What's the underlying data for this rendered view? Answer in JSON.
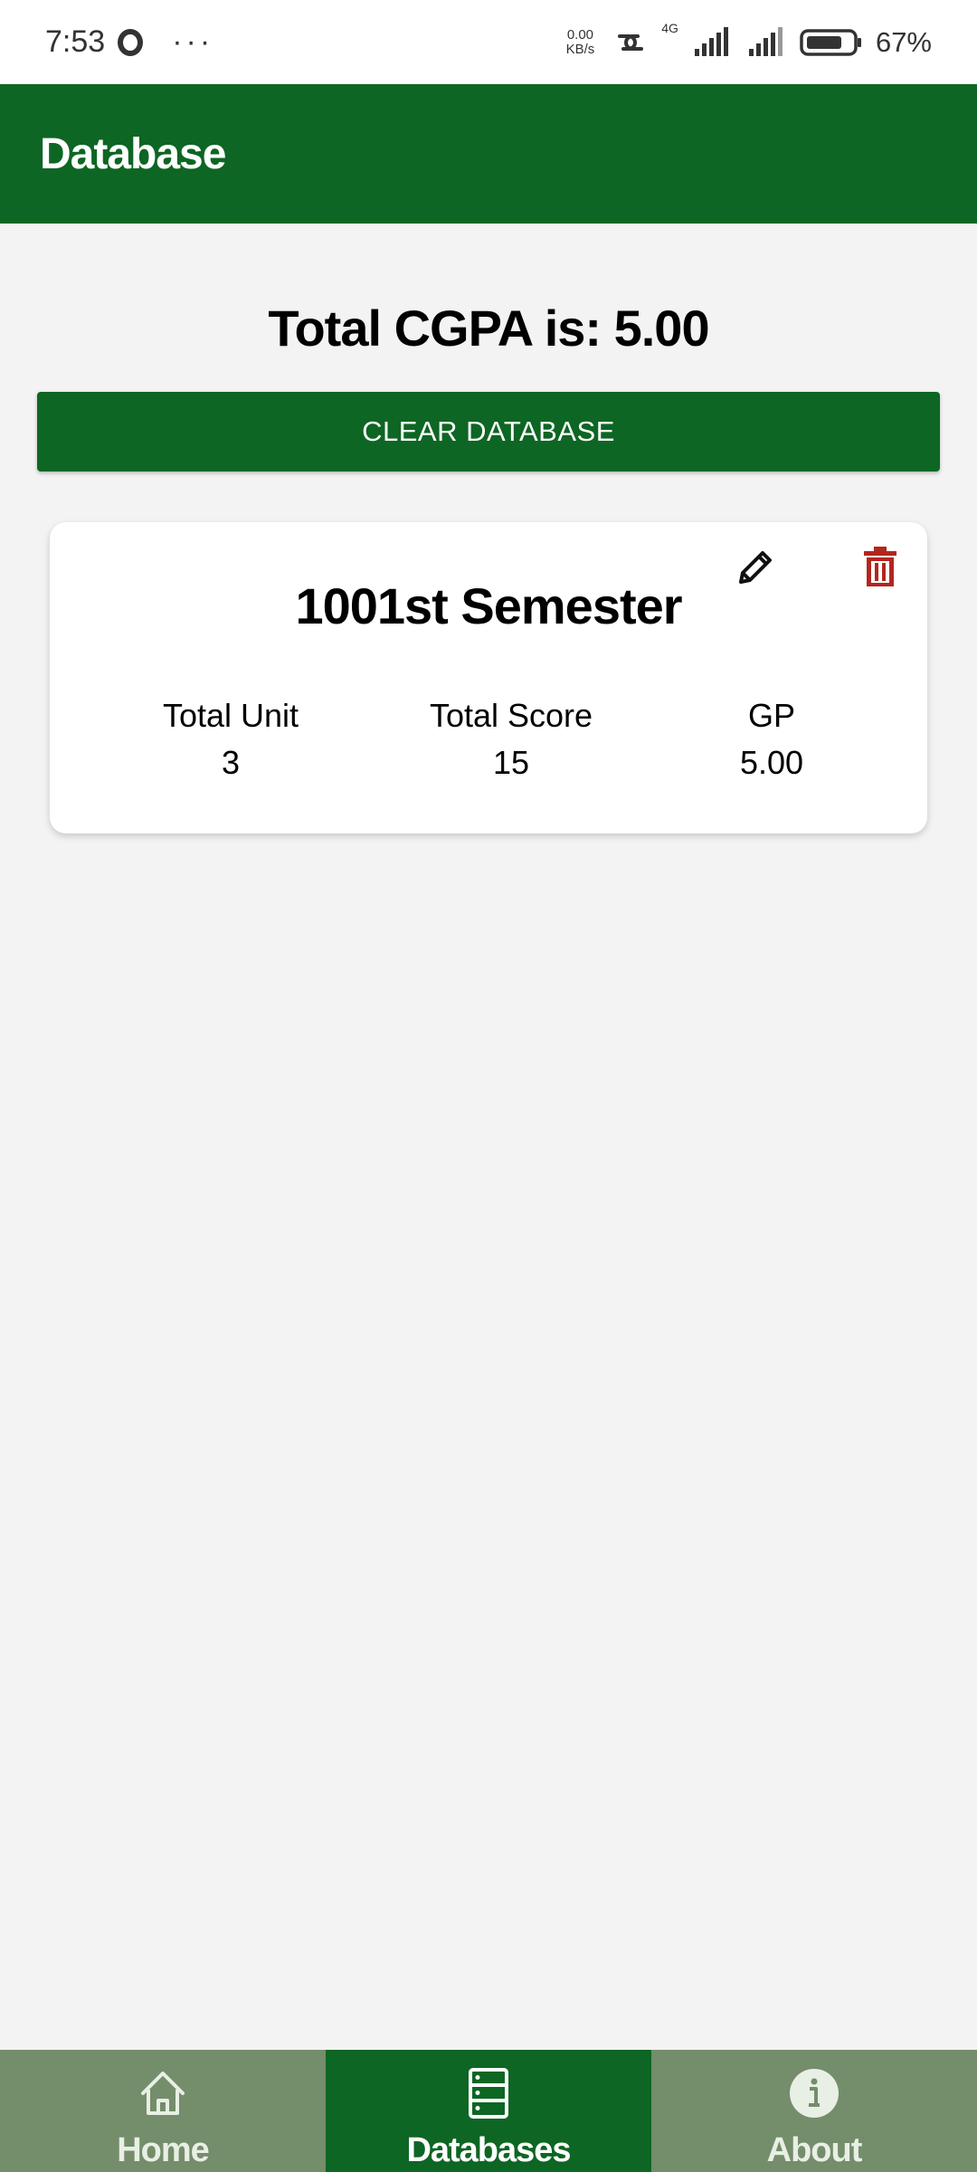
{
  "status_bar": {
    "time": "7:53",
    "dots": "···",
    "speed_value": "0.00",
    "speed_unit": "KB/s",
    "network": "4G",
    "battery": "67%"
  },
  "app_bar": {
    "title": "Database"
  },
  "main": {
    "total_cgpa": "Total CGPA is: 5.00",
    "clear_button": "CLEAR DATABASE"
  },
  "cards": [
    {
      "title": "1001st Semester",
      "total_unit_label": "Total Unit",
      "total_unit_value": "3",
      "total_score_label": "Total Score",
      "total_score_value": "15",
      "gp_label": "GP",
      "gp_value": "5.00",
      "edit_icon": "pencil-icon",
      "delete_icon": "trash-icon"
    }
  ],
  "bottom_nav": {
    "items": [
      {
        "label": "Home",
        "icon": "home-icon",
        "active": false
      },
      {
        "label": "Databases",
        "icon": "database-icon",
        "active": true
      },
      {
        "label": "About",
        "icon": "info-icon",
        "active": false
      }
    ]
  },
  "colors": {
    "primary": "#0d6623",
    "nav_inactive": "#748d6b",
    "delete": "#b3261e",
    "background": "#f3f3f3"
  }
}
